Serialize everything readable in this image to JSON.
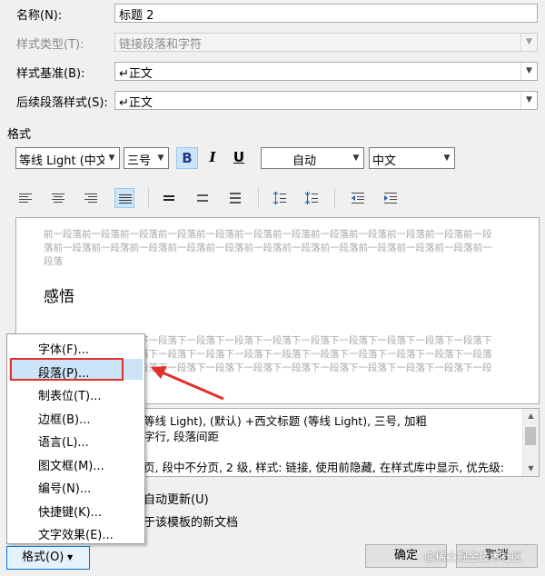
{
  "fields": {
    "name_label": "名称(N):",
    "name_value": "标题 2",
    "type_label": "样式类型(T):",
    "type_value": "链接段落和字符",
    "base_label": "样式基准(B):",
    "base_value": "↵正文",
    "next_label": "后续段落样式(S):",
    "next_value": "↵正文"
  },
  "format": {
    "section_label": "格式",
    "font": "等线 Light (中文",
    "size": "三号",
    "bold": "B",
    "italic": "I",
    "underline": "U",
    "color": "自动",
    "script": "中文"
  },
  "preview": {
    "prev_text": "前一段落前一段落前一段落前一段落前一段落前一段落前一段落前一段落前一段落前一段落前一段落前一段落前一段落前一段落前一段落前一段落前一段落前一段落前一段落前一段落前一段落前一段落前一段落前一段落",
    "sample": "感悟",
    "next_text": "段落下一段落下一段落下一段落下一段落下一段落下一段落下一段落下一段落下一段落下一段落下一段落下一段落下一段落下一段落下一段落下一段落下一段落下一段落下一段落下一段落下一段落下一段落下一段落下一段落下一段落下一段落下一段落下一段落下一段落下一段落下一段落下一段落下一段落下一段落下一段落下一段落下一段落下一段落下一段落下一段落下一段落下一段落下一段落下一段落下一段落下一段落下一段落下一段落下一段落下一段落下一段落下一段落下一段落下一段落下一段落下一段落下一段落下一段落下一段落下一段落下一段落下一段落下一段落"
  },
  "description": {
    "line1": "等线 Light), (默认) +西文标题 (等线 Light), 三号, 加粗",
    "line2": "字行, 段落间距",
    "line3": "页, 段中不分页, 2 级, 样式: 链接, 使用前隐藏, 在样式库中显示, 优先级:"
  },
  "options": {
    "auto_update": "自动更新(U)",
    "template_docs": "于该模板的新文档"
  },
  "menu": {
    "items": [
      "字体(F)...",
      "段落(P)...",
      "制表位(T)...",
      "边框(B)...",
      "语言(L)...",
      "图文框(M)...",
      "编号(N)...",
      "快捷键(K)...",
      "文字效果(E)..."
    ]
  },
  "buttons": {
    "format": "格式(O)",
    "ok": "确定",
    "cancel": "取消"
  },
  "watermark": "@稀土掘金技术社区",
  "colors": {
    "highlight": "#cce4f7",
    "annotation_red": "#e0302a"
  }
}
